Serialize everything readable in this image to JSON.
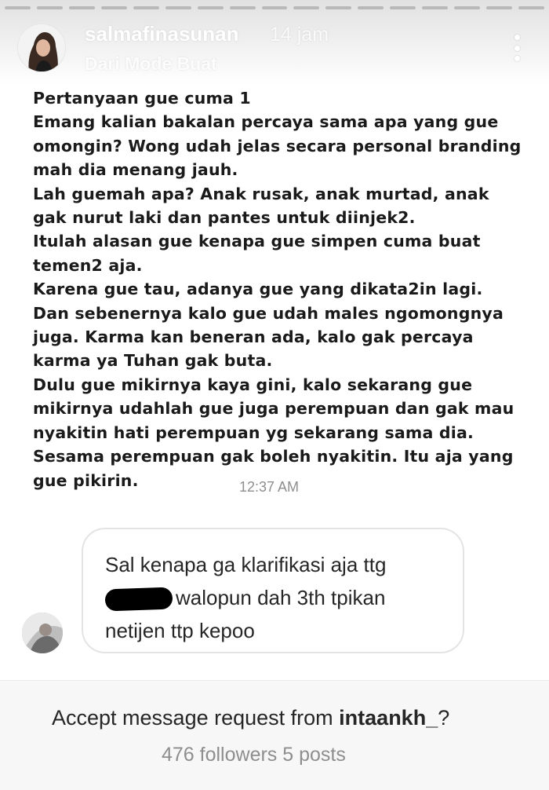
{
  "story": {
    "username": "salmafinasunan",
    "time_ago": "14 jam",
    "subtitle": "Dari Mode Buat",
    "progress_segments": 17
  },
  "message": {
    "lines": [
      "Pertanyaan gue cuma 1",
      "Emang kalian bakalan percaya sama apa yang gue",
      "omongin? Wong udah jelas secara personal branding",
      "mah dia menang jauh.",
      "Lah guemah apa? Anak rusak, anak murtad, anak",
      "gak nurut laki dan pantes untuk diinjek2.",
      "Itulah alasan gue kenapa gue simpen cuma buat",
      "temen2 aja.",
      "Karena gue tau, adanya gue yang dikata2in lagi.",
      "Dan sebenernya kalo gue udah males ngomongnya",
      "juga. Karma kan beneran ada, kalo gak percaya",
      "karma ya Tuhan gak buta.",
      "Dulu gue mikirnya kaya gini, kalo sekarang gue",
      "mikirnya udahlah gue juga perempuan dan gak mau",
      "nyakitin hati perempuan yg sekarang sama dia.",
      "Sesama perempuan gak boleh nyakitin. Itu aja yang",
      "gue pikirin."
    ],
    "time": "12:37 AM"
  },
  "incoming": {
    "line1": "Sal kenapa ga klarifikasi aja ttg",
    "line2": "walopun dah 3th tpikan",
    "line3": "netijen ttp kepoo"
  },
  "request": {
    "prompt_prefix": "Accept message request from ",
    "requester": "intaankh_",
    "prompt_suffix": "?",
    "meta": "476 followers 5 posts"
  },
  "icons": {
    "more": "more-vertical-icon"
  }
}
